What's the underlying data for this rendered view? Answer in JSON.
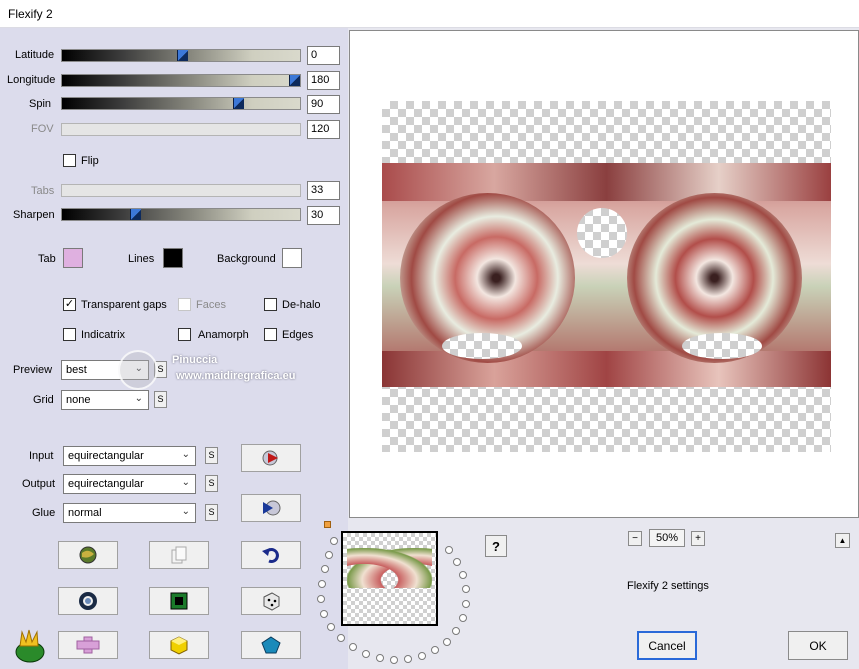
{
  "window": {
    "title": "Flexify 2"
  },
  "sliders": {
    "latitude": {
      "label": "Latitude",
      "value": "0"
    },
    "longitude": {
      "label": "Longitude",
      "value": "180"
    },
    "spin": {
      "label": "Spin",
      "value": "90"
    },
    "fov": {
      "label": "FOV",
      "value": "120"
    },
    "tabs": {
      "label": "Tabs",
      "value": "33"
    },
    "sharpen": {
      "label": "Sharpen",
      "value": "30"
    }
  },
  "checkboxes": {
    "flip": {
      "label": "Flip",
      "checked": false
    },
    "transparent_gaps": {
      "label": "Transparent gaps",
      "checked": true
    },
    "faces": {
      "label": "Faces",
      "checked": false
    },
    "de_halo": {
      "label": "De-halo",
      "checked": false
    },
    "indicatrix": {
      "label": "Indicatrix",
      "checked": false
    },
    "anamorph": {
      "label": "Anamorph",
      "checked": false
    },
    "edges": {
      "label": "Edges",
      "checked": false
    }
  },
  "colors": {
    "tab": {
      "label": "Tab",
      "value": "#dfb0e0"
    },
    "lines": {
      "label": "Lines",
      "value": "#000000"
    },
    "background": {
      "label": "Background",
      "value": "#ffffff"
    }
  },
  "selects": {
    "preview": {
      "label": "Preview",
      "value": "best"
    },
    "grid": {
      "label": "Grid",
      "value": "none"
    },
    "input": {
      "label": "Input",
      "value": "equirectangular"
    },
    "output": {
      "label": "Output",
      "value": "equirectangular"
    },
    "glue": {
      "label": "Glue",
      "value": "normal"
    }
  },
  "s_label": "S",
  "watermark": {
    "name": "Pinuccia",
    "url": "www.maidiregrafica.eu"
  },
  "zoom": {
    "minus": "−",
    "value": "50%",
    "plus": "+"
  },
  "help": "?",
  "settings_label": "Flexify 2 settings",
  "buttons": {
    "cancel": "Cancel",
    "ok": "OK"
  },
  "icons": [
    "play-red-icon",
    "play-blue-icon",
    "globe-icon",
    "copy-icon",
    "undo-icon",
    "ring-icon",
    "green-square-icon",
    "dice-icon",
    "logo-icon",
    "pink-cross-icon",
    "yellow-cube-icon",
    "pentagon-icon"
  ]
}
